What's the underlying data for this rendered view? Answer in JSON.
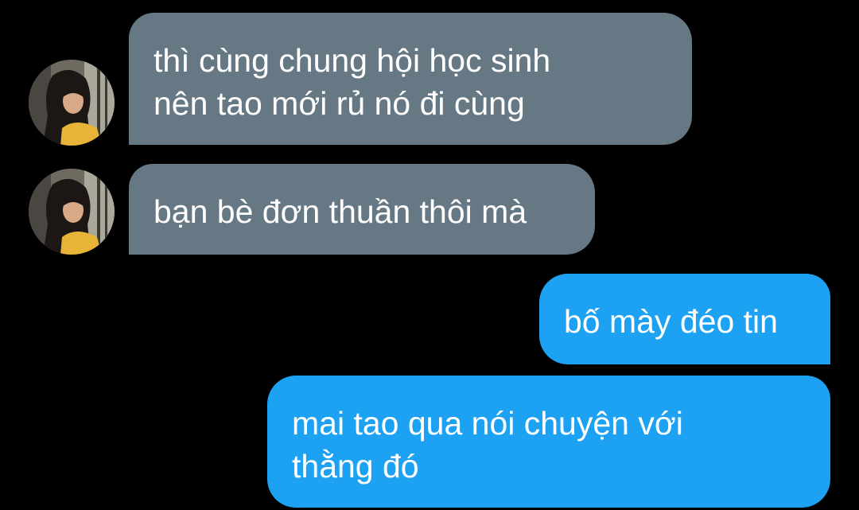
{
  "conversation": {
    "messages": [
      {
        "direction": "incoming",
        "lines": [
          "thì cùng chung hội học sinh",
          "nên tao mới rủ nó đi cùng"
        ],
        "avatar_icon": "profile-photo-icon"
      },
      {
        "direction": "incoming",
        "lines": [
          "bạn bè đơn thuần thôi mà"
        ],
        "avatar_icon": "profile-photo-icon"
      },
      {
        "direction": "outgoing",
        "lines": [
          "bố mày đéo tin"
        ]
      },
      {
        "direction": "outgoing",
        "lines": [
          "mai tao qua nói chuyện với",
          "thằng đó"
        ]
      }
    ]
  },
  "colors": {
    "background": "#000000",
    "incoming_bubble": "#677885",
    "outgoing_bubble": "#1da1f2",
    "text": "#ffffff"
  }
}
